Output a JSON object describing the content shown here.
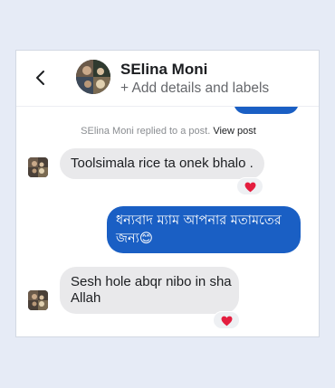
{
  "header": {
    "back_icon": "chevron-left",
    "contact_name": "SElina Moni",
    "add_details": "+ Add details and labels"
  },
  "reply_note": {
    "text": "SElina Moni replied to a post.",
    "link": "View post"
  },
  "messages": [
    {
      "direction": "incoming",
      "text": "Toolsimala rice ta onek bhalo .",
      "reaction": "heart"
    },
    {
      "direction": "outgoing",
      "line1": "ধন্যবাদ ম্যাম আপনার মতামতের",
      "line2": "জন্য😊"
    },
    {
      "direction": "incoming",
      "line1": "Sesh hole abqr nibo in sha",
      "line2": "Allah",
      "reaction": "heart"
    }
  ],
  "colors": {
    "page_bg": "#e6ebf6",
    "outgoing_bubble": "#1a5fc4",
    "incoming_bubble": "#e9e9eb",
    "reaction_heart": "#e41e3f"
  }
}
